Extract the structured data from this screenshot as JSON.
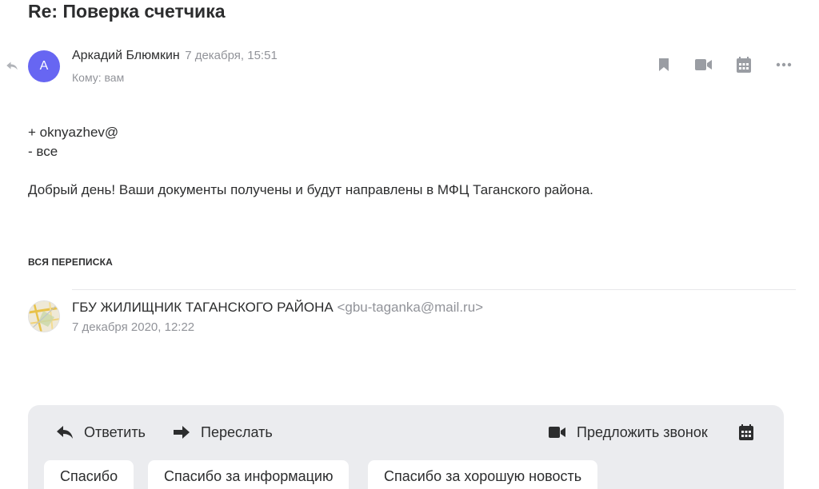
{
  "subject": "Re: Поверка счетчика",
  "message": {
    "avatar_letter": "А",
    "sender_name": "Аркадий Блюмкин",
    "date": "7 декабря, 15:51",
    "to": "Кому: вам",
    "body_lines": [
      "+ oknyazhev@",
      "- все"
    ],
    "body_paragraph": "Добрый день! Ваши документы получены и будут направлены в МФЦ Таганского района."
  },
  "top_actions": {
    "icons": [
      "bookmark-icon",
      "video-call-icon",
      "calendar-icon",
      "more-icon"
    ]
  },
  "thread": {
    "title": "ВСЯ ПЕРЕПИСКА",
    "sender_name": "ГБУ ЖИЛИЩНИК ТАГАНСКОГО РАЙОНА",
    "sender_email": "<gbu-taganka@mail.ru>",
    "date": "7 декабря 2020, 12:22"
  },
  "reply_panel": {
    "reply_label": "Ответить",
    "forward_label": "Переслать",
    "call_label": "Предложить звонок",
    "quick_replies": [
      "Спасибо",
      "Спасибо за информацию",
      "Спасибо за хорошую новость"
    ]
  },
  "colors": {
    "avatar": "#6766f2",
    "secondary_text": "#919399",
    "panel_bg": "#ebecef"
  }
}
